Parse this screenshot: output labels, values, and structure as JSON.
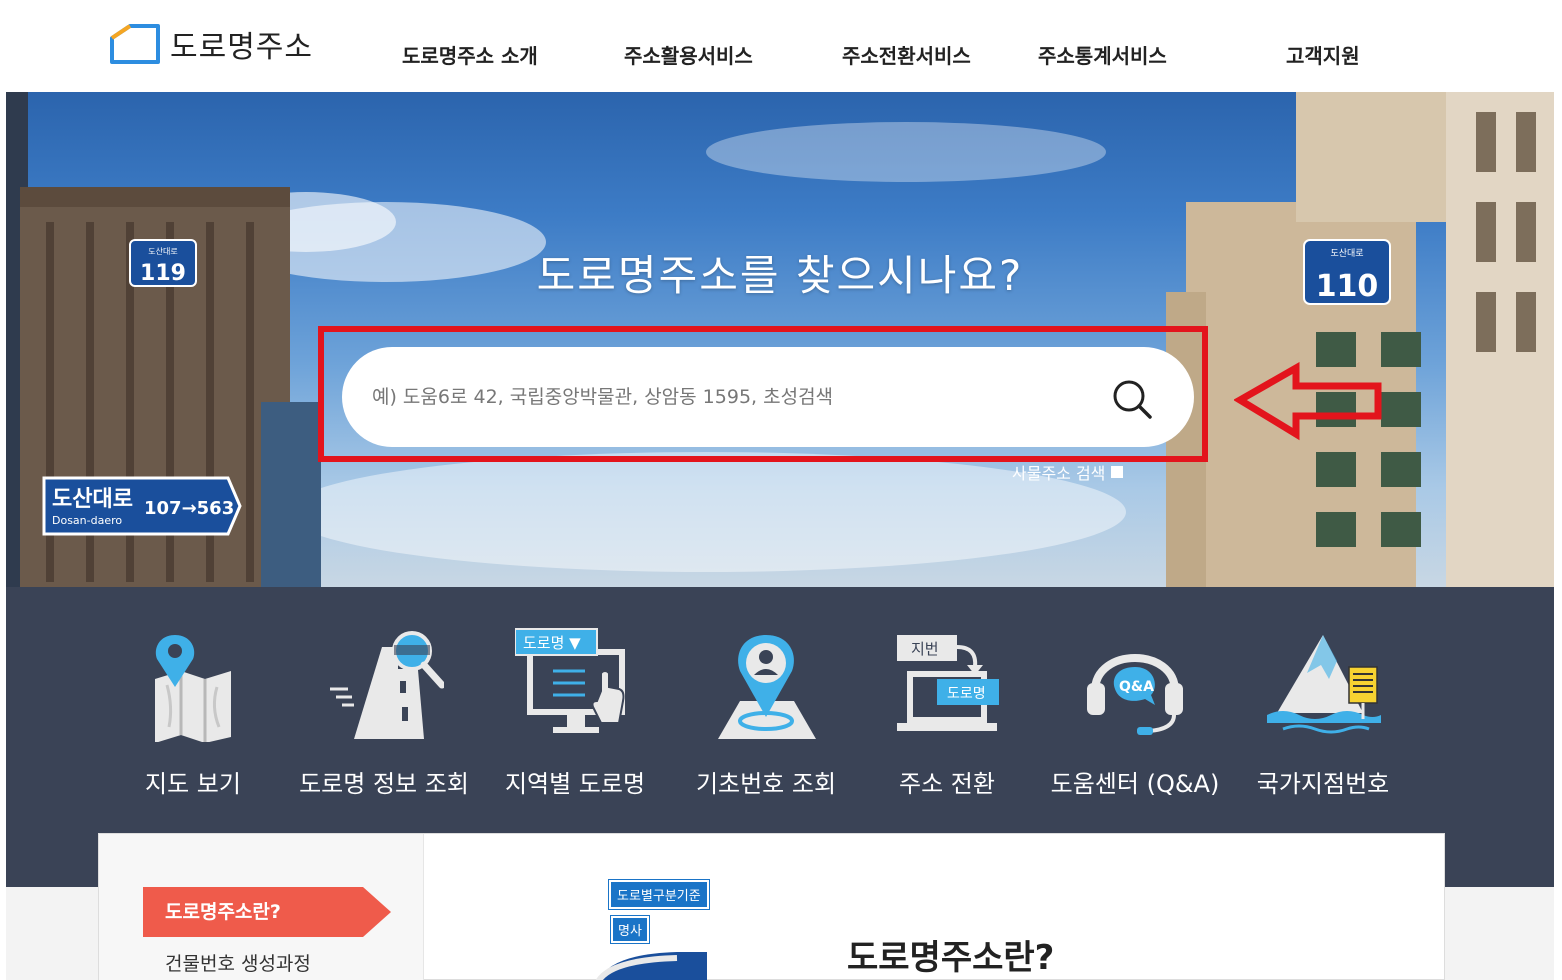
{
  "header": {
    "logo_text": "도로명주소",
    "nav": [
      {
        "label": "도로명주소 소개"
      },
      {
        "label": "주소활용서비스"
      },
      {
        "label": "주소전환서비스"
      },
      {
        "label": "주소통계서비스"
      },
      {
        "label": "고객지원"
      }
    ]
  },
  "hero": {
    "title": "도로명주소를 찾으시나요?",
    "search_placeholder": "예) 도움6로 42, 국립중앙박물관, 상암동 1595, 초성검색",
    "sub_option": "사물주소 검색",
    "signs": {
      "left_plate_small": "도산대로",
      "left_plate_number": "119",
      "right_plate_small": "도산대로",
      "right_plate_number": "110",
      "road_sign_name": "도산대로",
      "road_sign_roman": "Dosan-daero",
      "road_sign_range": "107→563"
    }
  },
  "quick_menu": [
    {
      "label": "지도 보기",
      "icon": "map-icon"
    },
    {
      "label": "도로명 정보 조회",
      "icon": "road-search-icon"
    },
    {
      "label": "지역별 도로명",
      "icon": "region-road-icon",
      "icon_text": "도로명 ▼"
    },
    {
      "label": "기초번호 조회",
      "icon": "location-pin-icon"
    },
    {
      "label": "주소 전환",
      "icon": "address-convert-icon",
      "icon_text_top": "지번",
      "icon_text_bottom": "도로명"
    },
    {
      "label": "도움센터 (Q&A)",
      "icon": "headset-icon",
      "icon_text": "Q&A"
    },
    {
      "label": "국가지점번호",
      "icon": "mountain-icon"
    }
  ],
  "content": {
    "side_active": "도로명주소란?",
    "side_item": "건물번호 생성과정",
    "badge_a": "도로별구분기준",
    "badge_b": "명사",
    "heading": "도로명주소란?"
  },
  "colors": {
    "highlight": "#e3141c",
    "quick_bg": "#3a4356",
    "active_tab": "#ef5b4b",
    "brand_blue": "#1a74c7"
  }
}
